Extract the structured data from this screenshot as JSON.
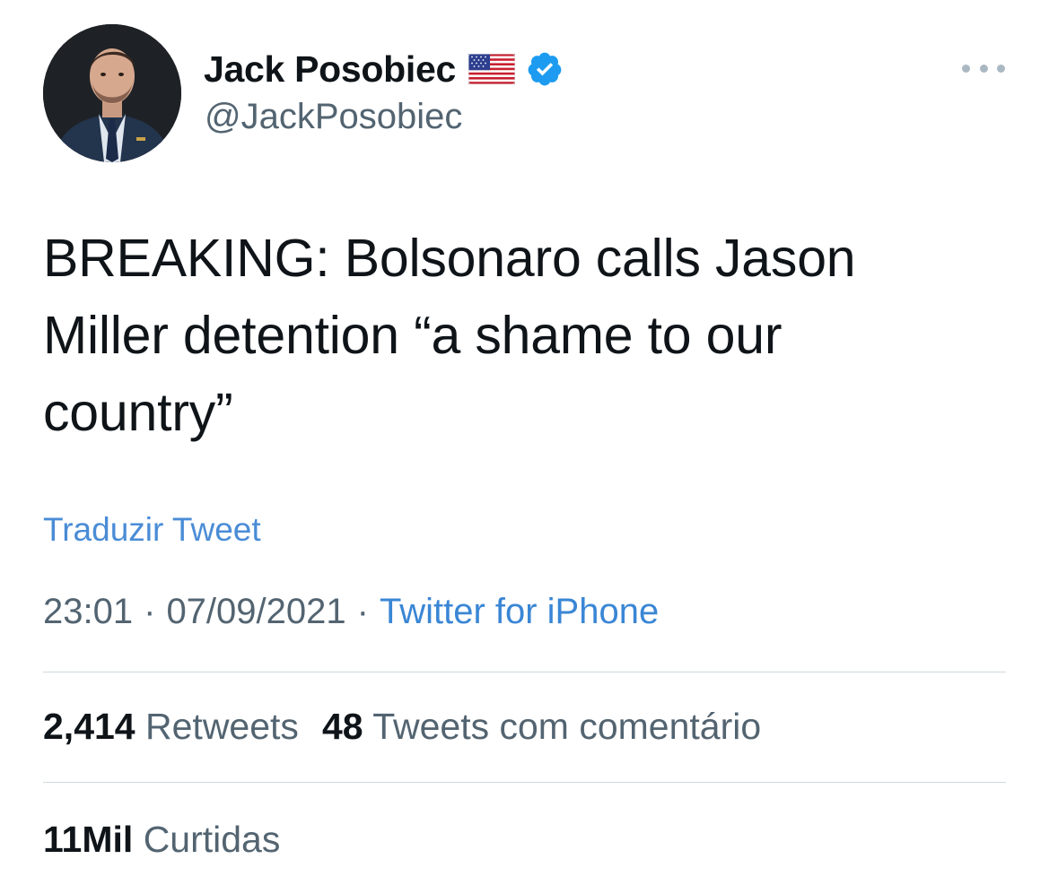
{
  "author": {
    "display_name": "Jack Posobiec",
    "handle": "@JackPosobiec",
    "avatar_icon": "profile-photo-man-in-suit",
    "flag_icon": "us-flag-icon",
    "verified_icon": "verified-badge-icon",
    "verified_color": "#1d9bf0"
  },
  "more_menu_icon": "more-dots-icon",
  "tweet": {
    "text": "BREAKING: Bolsonaro calls Jason\nMiller detention “a shame to our\ncountry”",
    "translate_label": "Traduzir Tweet"
  },
  "meta": {
    "time": "23:01",
    "separator_1": "·",
    "date": "07/09/2021",
    "separator_2": "·",
    "source": "Twitter for iPhone"
  },
  "stats": {
    "retweets_count": "2,414",
    "retweets_label": "Retweets",
    "quotes_count": "48",
    "quotes_label": "Tweets com comentário",
    "likes_count": "11Mil",
    "likes_label": "Curtidas"
  },
  "colors": {
    "text_primary": "#0f1419",
    "text_secondary": "#536471",
    "link": "#4a8cd6",
    "divider": "#cfd9de"
  }
}
